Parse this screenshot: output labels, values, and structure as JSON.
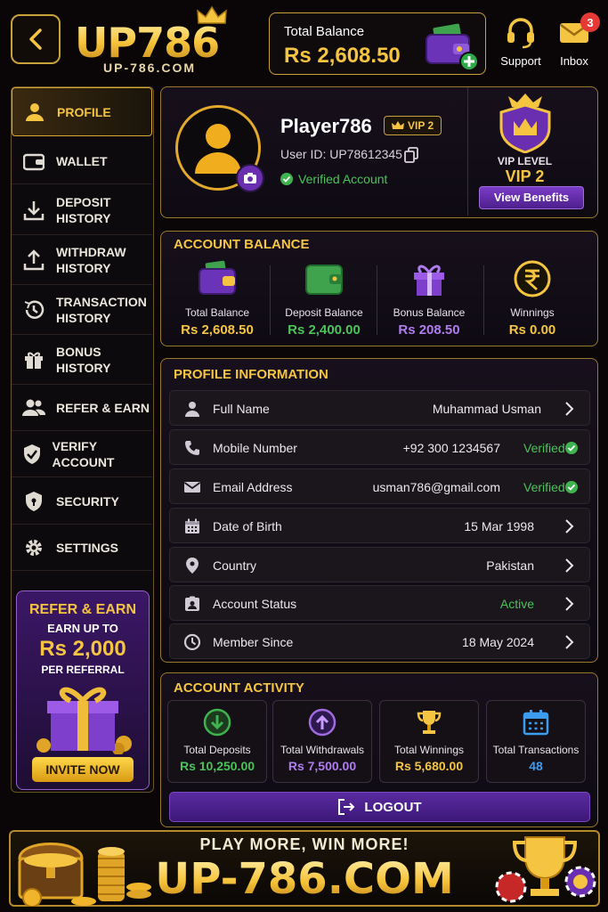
{
  "header": {
    "logo_text": "UP786",
    "logo_domain": "UP-786.COM",
    "total_balance_label": "Total Balance",
    "total_balance_value": "Rs 2,608.50",
    "support_label": "Support",
    "inbox_label": "Inbox",
    "inbox_badge": "3"
  },
  "sidebar": {
    "items": [
      {
        "label": "PROFILE",
        "icon": "user-icon"
      },
      {
        "label": "WALLET",
        "icon": "wallet-icon"
      },
      {
        "label": "DEPOSIT",
        "label2": "HISTORY",
        "icon": "download-icon"
      },
      {
        "label": "WITHDRAW",
        "label2": "HISTORY",
        "icon": "upload-icon"
      },
      {
        "label": "TRANSACTION",
        "label2": "HISTORY",
        "icon": "history-icon"
      },
      {
        "label": "BONUS",
        "label2": "HISTORY",
        "icon": "gift-icon"
      },
      {
        "label": "REFER & EARN",
        "icon": "users-icon"
      },
      {
        "label": "VERIFY ACCOUNT",
        "icon": "shield-check-icon"
      },
      {
        "label": "SECURITY",
        "icon": "shield-lock-icon"
      },
      {
        "label": "SETTINGS",
        "icon": "gear-icon"
      }
    ],
    "promo": {
      "title": "REFER & EARN",
      "earn_up_to": "EARN UP TO",
      "amount": "Rs 2,000",
      "per": "PER REFERRAL",
      "button": "INVITE NOW"
    }
  },
  "profile": {
    "name": "Player786",
    "vip_chip": "VIP 2",
    "user_id": "User ID: UP78612345",
    "verified": "Verified Account",
    "vip_level_label": "VIP LEVEL",
    "vip_level_value": "VIP 2",
    "view_benefits": "View Benefits"
  },
  "balance": {
    "title": "ACCOUNT BALANCE",
    "cells": [
      {
        "label": "Total Balance",
        "value": "Rs 2,608.50",
        "color": "#f5c542"
      },
      {
        "label": "Deposit Balance",
        "value": "Rs 2,400.00",
        "color": "#4ac35a"
      },
      {
        "label": "Bonus Balance",
        "value": "Rs 208.50",
        "color": "#b07cf0"
      },
      {
        "label": "Winnings",
        "value": "Rs 0.00",
        "color": "#f5c542"
      }
    ]
  },
  "info": {
    "title": "PROFILE INFORMATION",
    "rows": [
      {
        "label": "Full Name",
        "value": "Muhammad Usman",
        "icon": "user-icon"
      },
      {
        "label": "Mobile Number",
        "value": "+92 300 1234567",
        "status": "Verified",
        "icon": "phone-icon"
      },
      {
        "label": "Email Address",
        "value": "usman786@gmail.com",
        "status": "Verified",
        "icon": "mail-icon"
      },
      {
        "label": "Date of Birth",
        "value": "15 Mar 1998",
        "icon": "calendar-icon"
      },
      {
        "label": "Country",
        "value": "Pakistan",
        "icon": "location-icon"
      },
      {
        "label": "Account Status",
        "value": "Active",
        "icon": "id-card-icon"
      },
      {
        "label": "Member Since",
        "value": "18 May 2024",
        "icon": "clock-icon"
      }
    ]
  },
  "activity": {
    "title": "ACCOUNT ACTIVITY",
    "cells": [
      {
        "label": "Total Deposits",
        "value": "Rs 10,250.00",
        "color": "#4ac35a"
      },
      {
        "label": "Total Withdrawals",
        "value": "Rs 7,500.00",
        "color": "#b07cf0"
      },
      {
        "label": "Total Winnings",
        "value": "Rs 5,680.00",
        "color": "#f5c542"
      },
      {
        "label": "Total Transactions",
        "value": "48",
        "color": "#3b9cf0"
      }
    ],
    "logout": "LOGOUT"
  },
  "banner": {
    "tagline": "PLAY MORE, WIN MORE!",
    "domain": "UP-786.COM"
  }
}
